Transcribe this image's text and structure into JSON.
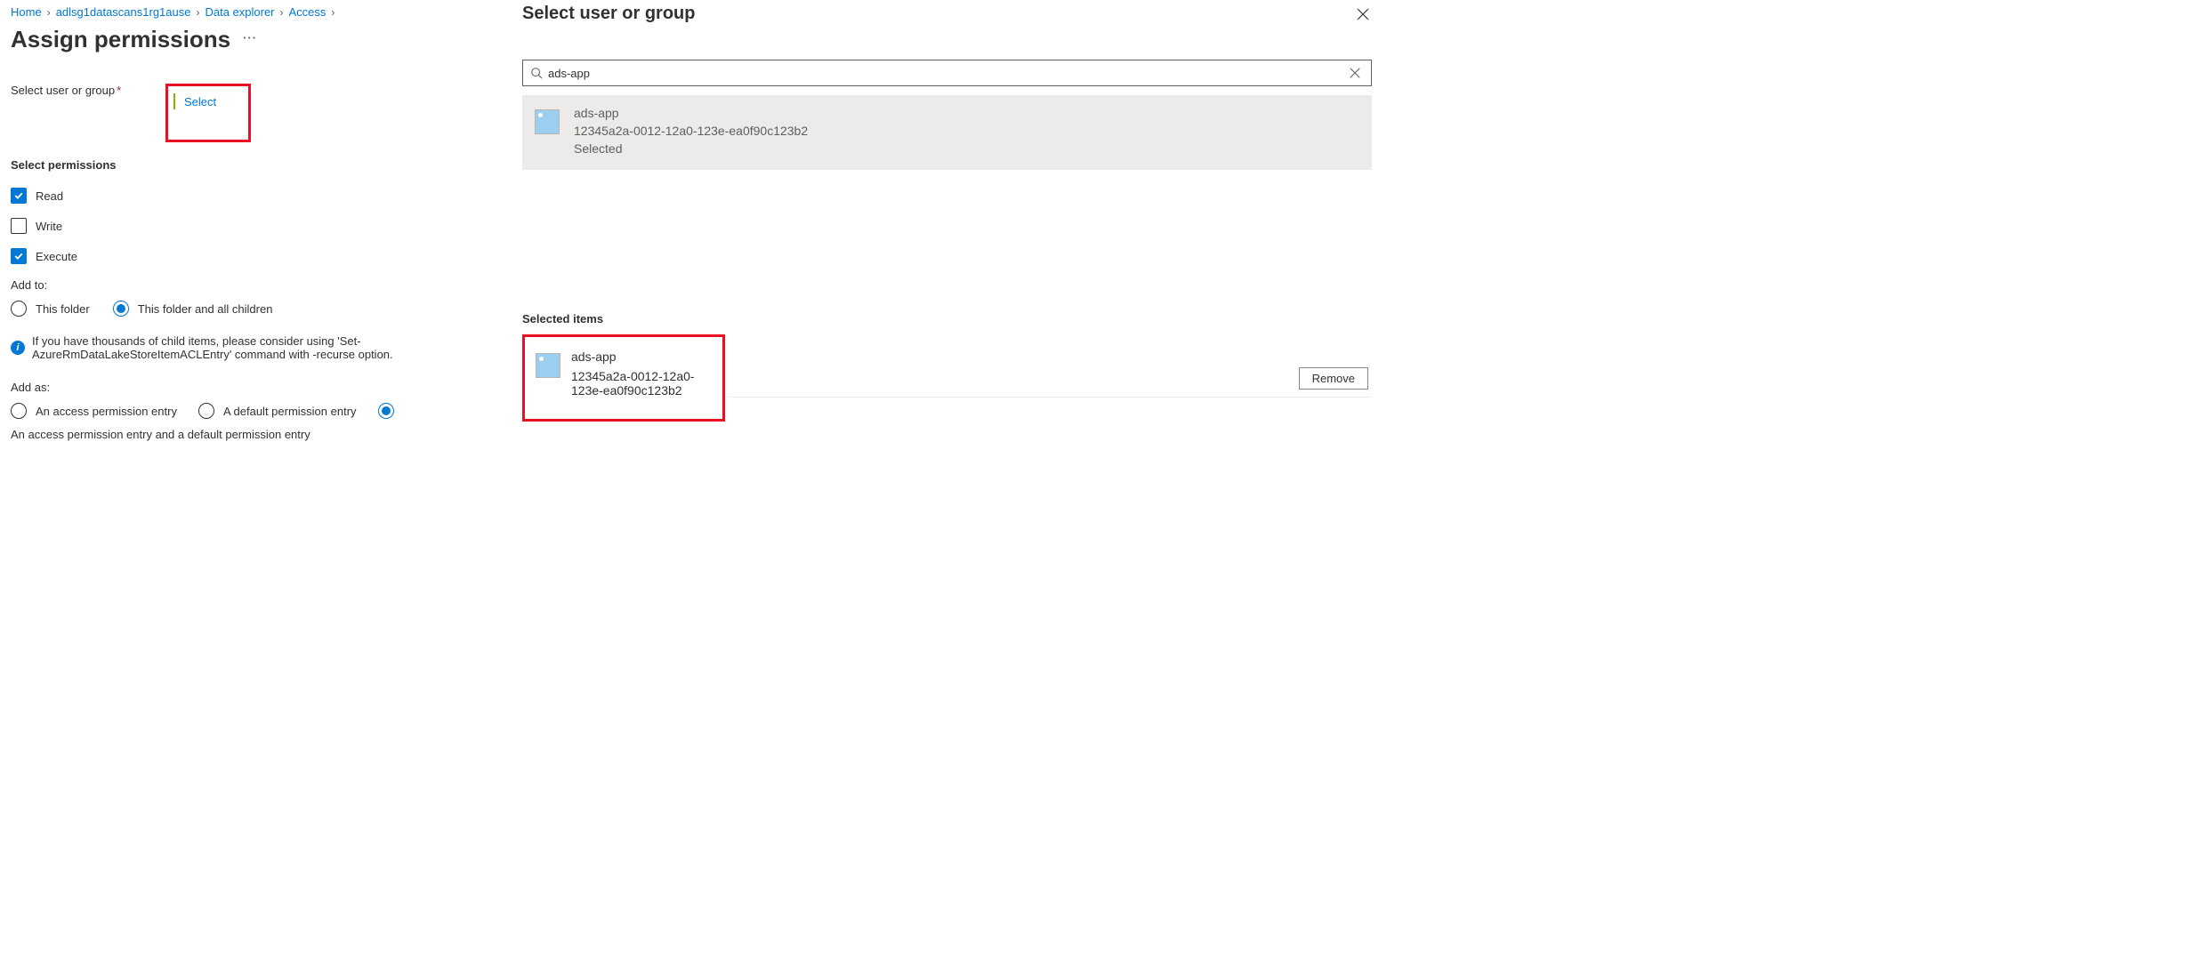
{
  "breadcrumb": [
    "Home",
    "adlsg1datascans1rg1ause",
    "Data explorer",
    "Access"
  ],
  "page_title": "Assign permissions",
  "left": {
    "select_label": "Select user or group",
    "select_link": "Select",
    "permissions_header": "Select permissions",
    "permissions": [
      {
        "label": "Read",
        "checked": true
      },
      {
        "label": "Write",
        "checked": false
      },
      {
        "label": "Execute",
        "checked": true
      }
    ],
    "add_to_label": "Add to:",
    "add_to_options": [
      {
        "label": "This folder",
        "selected": false
      },
      {
        "label": "This folder and all children",
        "selected": true
      }
    ],
    "info_text": "If you have thousands of child items, please consider using 'Set-AzureRmDataLakeStoreItemACLEntry' command with -recurse option.",
    "add_as_label": "Add as:",
    "add_as_options": [
      {
        "label": "An access permission entry",
        "selected": false
      },
      {
        "label": "A default permission entry",
        "selected": false
      },
      {
        "label": "An access permission entry and a default permission entry",
        "selected": true
      }
    ]
  },
  "right": {
    "panel_title": "Select user or group",
    "search_value": "ads-app",
    "result": {
      "name": "ads-app",
      "guid": "12345a2a-0012-12a0-123e-ea0f90c123b2",
      "status": "Selected"
    },
    "selected_header": "Selected items",
    "selected": {
      "name": "ads-app",
      "guid": "12345a2a-0012-12a0-123e-ea0f90c123b2"
    },
    "remove_label": "Remove"
  }
}
